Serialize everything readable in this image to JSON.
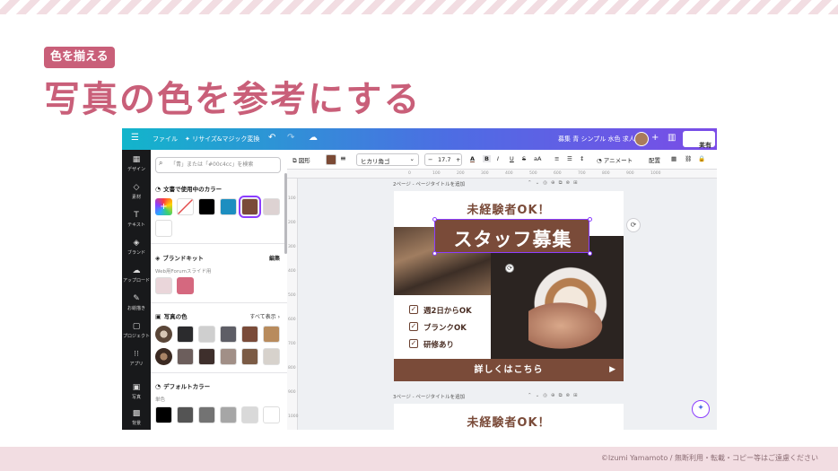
{
  "slide": {
    "tag": "色を揃える",
    "headline": "写真の色を参考にする",
    "copyright": "©Izumi Yamamoto / 無断利用・転載・コピー等はご遠慮ください"
  },
  "app": {
    "topbar": {
      "menu_icon": "☰",
      "file": "ファイル",
      "resize": "リサイズ&マジック変換",
      "undo_icon": "↶",
      "redo_icon": "↷",
      "cloud_icon": "☁",
      "doc_title": "募集 青 シンプル 水色 求人",
      "plus_icon": "+",
      "stats_icon": "▥",
      "share": "共有",
      "share_icon": "⇪"
    },
    "rail": [
      {
        "icon": "▦",
        "label": "デザイン"
      },
      {
        "icon": "◇",
        "label": "素材"
      },
      {
        "icon": "T",
        "label": "テキスト"
      },
      {
        "icon": "◈",
        "label": "ブランド"
      },
      {
        "icon": "☁",
        "label": "アップロード"
      },
      {
        "icon": "✎",
        "label": "お絵描き"
      },
      {
        "icon": "▢",
        "label": "プロジェクト"
      },
      {
        "icon": "⁝⁝",
        "label": "アプリ"
      },
      {
        "icon": "▣",
        "label": "写真"
      },
      {
        "icon": "▩",
        "label": "背景"
      }
    ],
    "panel": {
      "search_icon": "⌕",
      "search_placeholder": "「青」または「#00c4cc」を検索",
      "doc_colors_title": "文書で使用中のカラー",
      "doc_colors_icon": "◔",
      "doc_colors": [
        "#ffffff",
        "#000000",
        "#1d8ec0",
        "#7a4b39",
        "#ddd2d2"
      ],
      "add_color_icon": "+",
      "brand_title": "ブランドキット",
      "brand_icon": "◈",
      "brand_edit": "編集",
      "brand_sub": "Web用Forumスライド用",
      "brand_colors": [
        "#ead6da",
        "#d5687f"
      ],
      "photo_title": "写真の色",
      "photo_icon": "▣",
      "photo_link": "すべて表示 ›",
      "photo_row1": [
        "#2b2b2d",
        "#cfcfcf",
        "#5e5e66",
        "#7a4b39",
        "#b88b5d"
      ],
      "photo_row2": [
        "#6c5e5c",
        "#3e2f2c",
        "#a18f87",
        "#7b5b45",
        "#d7d2cc"
      ],
      "default_title": "デフォルトカラー",
      "default_icon": "◔",
      "default_sub": "単色",
      "default_colors": [
        "#000000",
        "#545454",
        "#737373",
        "#a6a6a6",
        "#d9d9d9",
        "#ffffff"
      ]
    },
    "toolbar": {
      "effects": "図形",
      "font": "ヒカリ角ゴ",
      "size": "17.7",
      "minus": "−",
      "plus": "+",
      "text_color": "A",
      "bold": "B",
      "italic": "I",
      "underline": "U",
      "strike": "S",
      "case": "aA",
      "align": "≡",
      "list": "☰",
      "spacing": "↕",
      "animate": "アニメート",
      "position": "配置",
      "transparency": "▦",
      "link": "⛓",
      "lock": "🔒"
    },
    "ruler_top": [
      "0",
      "100",
      "200",
      "300",
      "400",
      "500",
      "600",
      "700",
      "800",
      "900",
      "1000"
    ],
    "ruler_left": [
      "100",
      "200",
      "300",
      "400",
      "500",
      "600",
      "700",
      "800",
      "900",
      "1000"
    ],
    "page2": {
      "label": "2ページ - ページタイトルを追加",
      "icons": "⌃⌄◎⊕⧉⊗⊞"
    },
    "page3": {
      "label": "3ページ - ページタイトルを追加",
      "icons": "⌃⌄◎⊕⧉⊗⊞"
    },
    "design": {
      "top_text": "未経験者OK！",
      "title": "スタッフ募集",
      "checks": [
        "週2日からOK",
        "ブランクOK",
        "研修あり"
      ],
      "check_mark": "✓",
      "cta": "詳しくはこちら",
      "cta_arrow": "▶",
      "rotate_icon": "⟳"
    },
    "page3_design": {
      "top_text": "未経験者OK！"
    },
    "refresh_icon": "⟳",
    "magic_icon": "✦"
  }
}
